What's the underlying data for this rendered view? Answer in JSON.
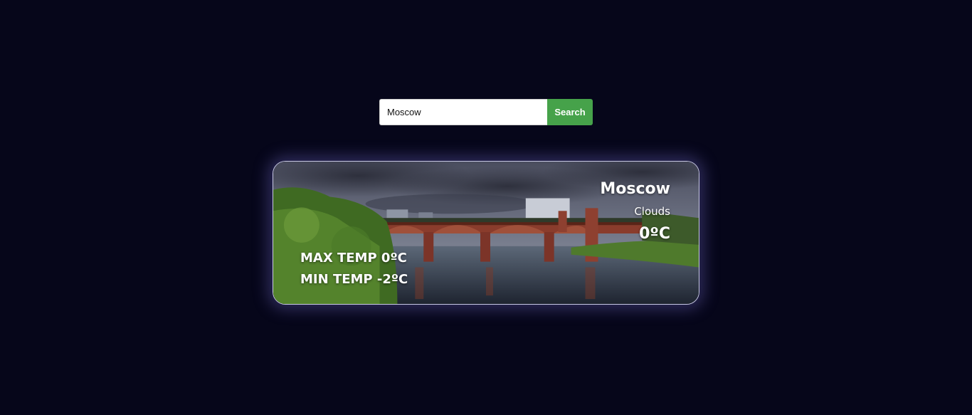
{
  "search": {
    "value": "Moscow",
    "button_label": "Search"
  },
  "weather": {
    "city": "Moscow",
    "condition": "Clouds",
    "temperature": "0ºC",
    "max_temp": "MAX TEMP 0ºC",
    "min_temp": "MIN TEMP -2ºC"
  },
  "colors": {
    "background": "#06061a",
    "search_button": "#46a24a"
  }
}
